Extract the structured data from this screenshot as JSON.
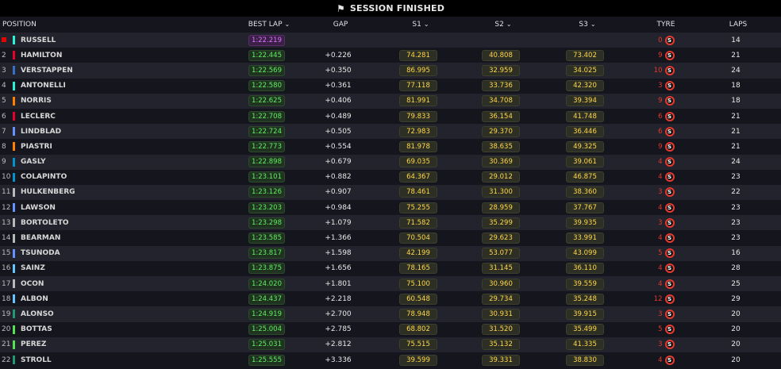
{
  "session": {
    "title": "SESSION FINISHED"
  },
  "columns": {
    "position": "POSITION",
    "best_lap": "BEST LAP",
    "gap": "GAP",
    "s1": "S1",
    "s2": "S2",
    "s3": "S3",
    "tyre": "TYRE",
    "laps": "LAPS"
  },
  "colors": {
    "personal_best": "#5ff060",
    "overall_best": "#e070ff",
    "sector": "#ffd84a",
    "soft_tyre": "#e63a2e"
  },
  "rows": [
    {
      "pos": "",
      "team_color": "#27f4d2",
      "driver": "RUSSELL",
      "best": "1:22.219",
      "best_kind": "purple",
      "gap": "",
      "s1": "",
      "s2": "",
      "s3": "",
      "tyre_age": "0",
      "tyre": "S",
      "laps": "14"
    },
    {
      "pos": "2",
      "team_color": "#e8002d",
      "driver": "HAMILTON",
      "best": "1:22.445",
      "best_kind": "green",
      "gap": "+0.226",
      "s1": "74.281",
      "s2": "40.808",
      "s3": "73.402",
      "tyre_age": "9",
      "tyre": "S",
      "laps": "21"
    },
    {
      "pos": "3",
      "team_color": "#3671c6",
      "driver": "VERSTAPPEN",
      "best": "1:22.569",
      "best_kind": "green",
      "gap": "+0.350",
      "s1": "86.995",
      "s2": "32.959",
      "s3": "34.025",
      "tyre_age": "10",
      "tyre": "S",
      "laps": "24"
    },
    {
      "pos": "4",
      "team_color": "#27f4d2",
      "driver": "ANTONELLI",
      "best": "1:22.580",
      "best_kind": "green",
      "gap": "+0.361",
      "s1": "77.118",
      "s2": "33.736",
      "s3": "42.320",
      "tyre_age": "3",
      "tyre": "S",
      "laps": "18"
    },
    {
      "pos": "5",
      "team_color": "#ff8000",
      "driver": "NORRIS",
      "best": "1:22.625",
      "best_kind": "green",
      "gap": "+0.406",
      "s1": "81.991",
      "s2": "34.708",
      "s3": "39.394",
      "tyre_age": "9",
      "tyre": "S",
      "laps": "18"
    },
    {
      "pos": "6",
      "team_color": "#e8002d",
      "driver": "LECLERC",
      "best": "1:22.708",
      "best_kind": "green",
      "gap": "+0.489",
      "s1": "79.833",
      "s2": "36.154",
      "s3": "41.748",
      "tyre_age": "6",
      "tyre": "S",
      "laps": "21"
    },
    {
      "pos": "7",
      "team_color": "#6692ff",
      "driver": "LINDBLAD",
      "best": "1:22.724",
      "best_kind": "green",
      "gap": "+0.505",
      "s1": "72.983",
      "s2": "29.370",
      "s3": "36.446",
      "tyre_age": "6",
      "tyre": "S",
      "laps": "21"
    },
    {
      "pos": "8",
      "team_color": "#ff8000",
      "driver": "PIASTRI",
      "best": "1:22.773",
      "best_kind": "green",
      "gap": "+0.554",
      "s1": "81.978",
      "s2": "38.635",
      "s3": "49.325",
      "tyre_age": "9",
      "tyre": "S",
      "laps": "21"
    },
    {
      "pos": "9",
      "team_color": "#0093cc",
      "driver": "GASLY",
      "best": "1:22.898",
      "best_kind": "green",
      "gap": "+0.679",
      "s1": "69.035",
      "s2": "30.369",
      "s3": "39.061",
      "tyre_age": "4",
      "tyre": "S",
      "laps": "24"
    },
    {
      "pos": "10",
      "team_color": "#0093cc",
      "driver": "COLAPINTO",
      "best": "1:23.101",
      "best_kind": "green",
      "gap": "+0.882",
      "s1": "64.367",
      "s2": "29.012",
      "s3": "46.875",
      "tyre_age": "4",
      "tyre": "S",
      "laps": "23"
    },
    {
      "pos": "11",
      "team_color": "#b6babd",
      "driver": "HULKENBERG",
      "best": "1:23.126",
      "best_kind": "green",
      "gap": "+0.907",
      "s1": "78.461",
      "s2": "31.300",
      "s3": "38.360",
      "tyre_age": "3",
      "tyre": "S",
      "laps": "22"
    },
    {
      "pos": "12",
      "team_color": "#6692ff",
      "driver": "LAWSON",
      "best": "1:23.203",
      "best_kind": "green",
      "gap": "+0.984",
      "s1": "75.255",
      "s2": "28.959",
      "s3": "37.767",
      "tyre_age": "4",
      "tyre": "S",
      "laps": "23"
    },
    {
      "pos": "13",
      "team_color": "#b6babd",
      "driver": "BORTOLETO",
      "best": "1:23.298",
      "best_kind": "green",
      "gap": "+1.079",
      "s1": "71.582",
      "s2": "35.299",
      "s3": "39.935",
      "tyre_age": "3",
      "tyre": "S",
      "laps": "23"
    },
    {
      "pos": "14",
      "team_color": "#b6babd",
      "driver": "BEARMAN",
      "best": "1:23.585",
      "best_kind": "green",
      "gap": "+1.366",
      "s1": "70.504",
      "s2": "29.623",
      "s3": "33.991",
      "tyre_age": "4",
      "tyre": "S",
      "laps": "23"
    },
    {
      "pos": "15",
      "team_color": "#6692ff",
      "driver": "TSUNODA",
      "best": "1:23.817",
      "best_kind": "green",
      "gap": "+1.598",
      "s1": "42.199",
      "s2": "53.077",
      "s3": "43.099",
      "tyre_age": "5",
      "tyre": "S",
      "laps": "16"
    },
    {
      "pos": "16",
      "team_color": "#64c4ff",
      "driver": "SAINZ",
      "best": "1:23.875",
      "best_kind": "green",
      "gap": "+1.656",
      "s1": "78.165",
      "s2": "31.145",
      "s3": "36.110",
      "tyre_age": "4",
      "tyre": "S",
      "laps": "28"
    },
    {
      "pos": "17",
      "team_color": "#b6babd",
      "driver": "OCON",
      "best": "1:24.020",
      "best_kind": "green",
      "gap": "+1.801",
      "s1": "75.100",
      "s2": "30.960",
      "s3": "39.559",
      "tyre_age": "4",
      "tyre": "S",
      "laps": "25"
    },
    {
      "pos": "18",
      "team_color": "#64c4ff",
      "driver": "ALBON",
      "best": "1:24.437",
      "best_kind": "green",
      "gap": "+2.218",
      "s1": "60.548",
      "s2": "29.734",
      "s3": "35.248",
      "tyre_age": "12",
      "tyre": "S",
      "laps": "29"
    },
    {
      "pos": "19",
      "team_color": "#229971",
      "driver": "ALONSO",
      "best": "1:24.919",
      "best_kind": "green",
      "gap": "+2.700",
      "s1": "78.948",
      "s2": "30.931",
      "s3": "39.915",
      "tyre_age": "3",
      "tyre": "S",
      "laps": "20"
    },
    {
      "pos": "20",
      "team_color": "#52e252",
      "driver": "BOTTAS",
      "best": "1:25.004",
      "best_kind": "green",
      "gap": "+2.785",
      "s1": "68.802",
      "s2": "31.520",
      "s3": "35.499",
      "tyre_age": "5",
      "tyre": "S",
      "laps": "20"
    },
    {
      "pos": "21",
      "team_color": "#52e252",
      "driver": "PEREZ",
      "best": "1:25.031",
      "best_kind": "green",
      "gap": "+2.812",
      "s1": "75.515",
      "s2": "35.132",
      "s3": "41.335",
      "tyre_age": "3",
      "tyre": "S",
      "laps": "20"
    },
    {
      "pos": "22",
      "team_color": "#229971",
      "driver": "STROLL",
      "best": "1:25.555",
      "best_kind": "green",
      "gap": "+3.336",
      "s1": "39.599",
      "s2": "39.331",
      "s3": "38.830",
      "tyre_age": "4",
      "tyre": "S",
      "laps": "20"
    }
  ]
}
